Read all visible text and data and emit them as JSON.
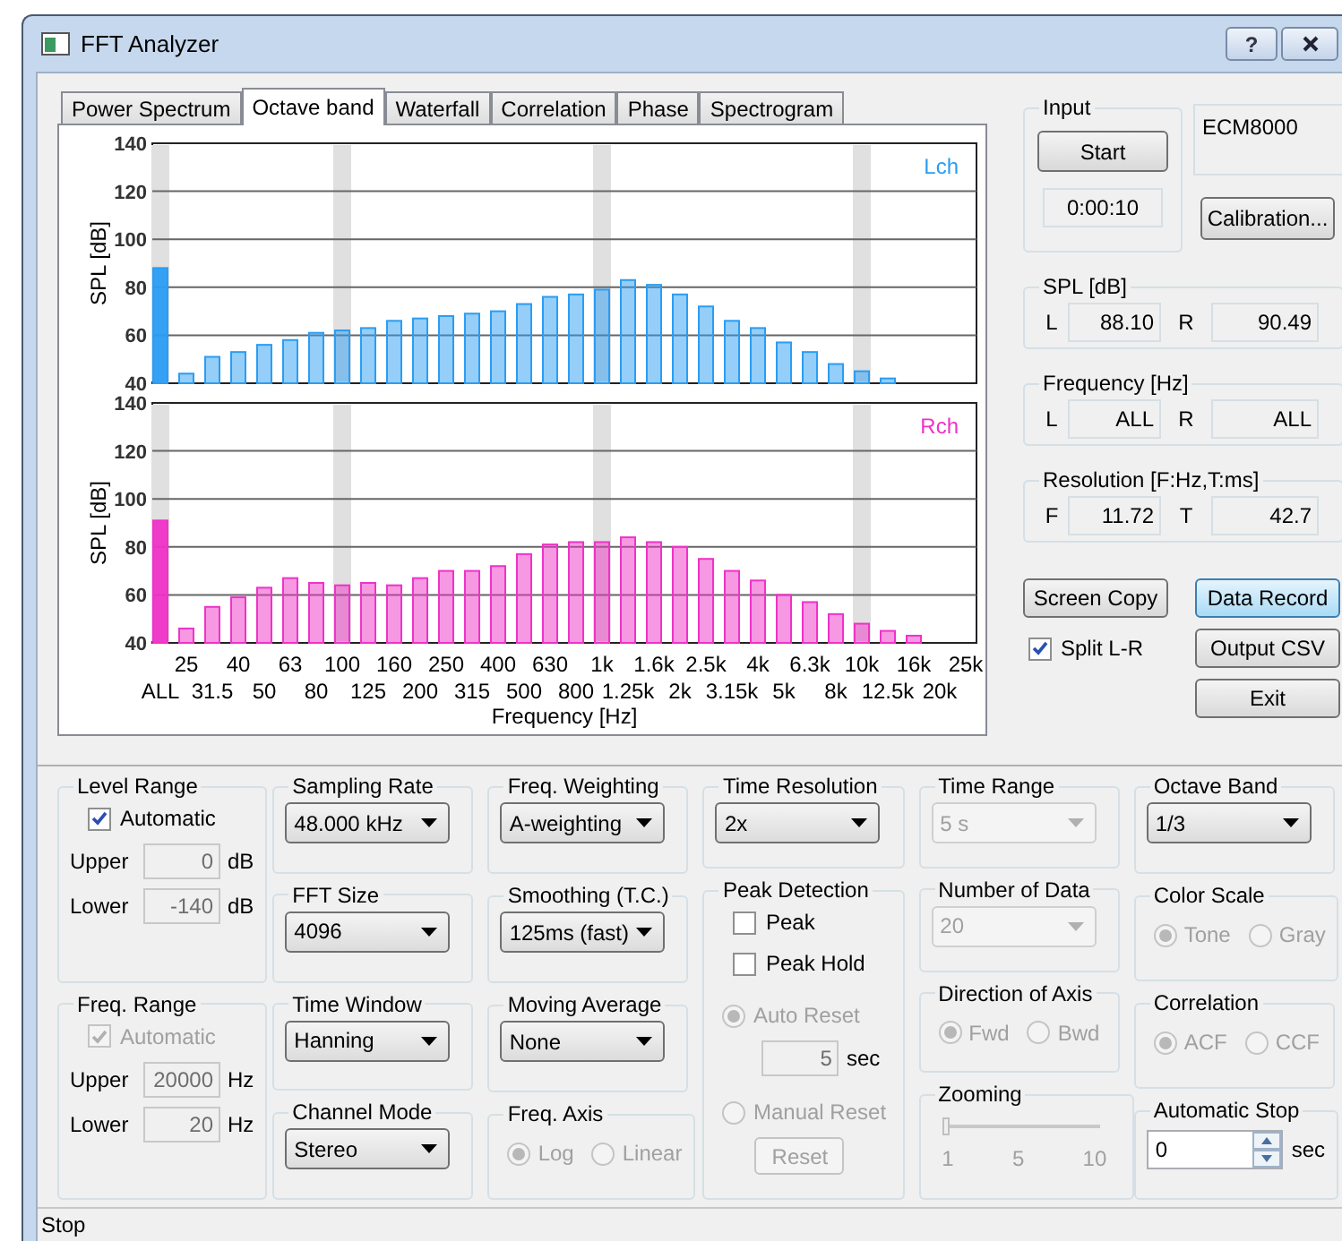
{
  "window": {
    "title": "FFT Analyzer",
    "help_button": "?"
  },
  "tabs": [
    {
      "label": "Power Spectrum",
      "selected": false
    },
    {
      "label": "Octave band",
      "selected": true
    },
    {
      "label": "Waterfall",
      "selected": false
    },
    {
      "label": "Correlation",
      "selected": false
    },
    {
      "label": "Phase",
      "selected": false
    },
    {
      "label": "Spectrogram",
      "selected": false
    }
  ],
  "plots": [
    {
      "chart_data": {
        "type": "bar",
        "grid": true,
        "ylabel": "SPL [dB]",
        "ylim": [
          40,
          140
        ],
        "yticks": [
          40,
          60,
          80,
          100,
          120,
          140
        ],
        "series": [
          {
            "name": "Lch",
            "color": "#2a9df4",
            "values": [
              88,
              44,
              51,
              53,
              56,
              58,
              61,
              62,
              63,
              66,
              67,
              68,
              69,
              70,
              73,
              76,
              77,
              79,
              83,
              81,
              77,
              72,
              66,
              63,
              57,
              53,
              48,
              45,
              42,
              null,
              null,
              null
            ]
          }
        ]
      }
    },
    {
      "chart_data": {
        "type": "bar",
        "grid": true,
        "xlabel": "Frequency [Hz]",
        "ylabel": "SPL [dB]",
        "ylim": [
          40,
          140
        ],
        "yticks": [
          40,
          60,
          80,
          100,
          120,
          140
        ],
        "categories": [
          "ALL",
          "25",
          "31.5",
          "40",
          "50",
          "63",
          "80",
          "100",
          "125",
          "160",
          "200",
          "250",
          "315",
          "400",
          "500",
          "630",
          "800",
          "1k",
          "1.25k",
          "1.6k",
          "2k",
          "2.5k",
          "3.15k",
          "4k",
          "5k",
          "6.3k",
          "8k",
          "10k",
          "12.5k",
          "16k",
          "20k",
          "25k"
        ],
        "series": [
          {
            "name": "Rch",
            "color": "#f032c8",
            "values": [
              91,
              46,
              55,
              59,
              63,
              67,
              65,
              64,
              65,
              64,
              67,
              70,
              70,
              72,
              77,
              81,
              82,
              82,
              84,
              82,
              80,
              75,
              70,
              66,
              60,
              57,
              52,
              48,
              45,
              43,
              null,
              null
            ]
          }
        ]
      }
    }
  ],
  "input": {
    "title": "Input",
    "start_button": "Start",
    "elapsed": "0:00:10"
  },
  "device": {
    "name": "ECM8000",
    "calibration_button": "Calibration..."
  },
  "readouts": [
    {
      "title": "SPL [dB]",
      "fields": [
        {
          "label": "L",
          "value": "88.10"
        },
        {
          "label": "R",
          "value": "90.49"
        }
      ]
    },
    {
      "title": "Frequency [Hz]",
      "fields": [
        {
          "label": "L",
          "value": "ALL"
        },
        {
          "label": "R",
          "value": "ALL"
        }
      ]
    },
    {
      "title": "Resolution [F:Hz,T:ms]",
      "fields": [
        {
          "label": "F",
          "value": "11.72"
        },
        {
          "label": "T",
          "value": "42.7"
        }
      ]
    }
  ],
  "actions": {
    "screen_copy": {
      "label": "Screen Copy",
      "highlighted": false
    },
    "data_record": {
      "label": "Data Record",
      "highlighted": true
    },
    "split": {
      "label": "Split L-R",
      "checked": true
    },
    "output_csv": {
      "label": "Output CSV",
      "highlighted": false
    },
    "exit": {
      "label": "Exit",
      "highlighted": false
    }
  },
  "settings": {
    "columns": [
      [
        {
          "title": "Level Range",
          "controls": [
            {
              "kind": "checkbox",
              "label": "Automatic",
              "checked": true,
              "disabled": false
            },
            {
              "kind": "field",
              "label": "Upper",
              "value": "0",
              "unit": "dB",
              "disabled": true
            },
            {
              "kind": "field",
              "label": "Lower",
              "value": "-140",
              "unit": "dB",
              "disabled": true
            }
          ]
        },
        {
          "title": "Freq. Range",
          "controls": [
            {
              "kind": "checkbox",
              "label": "Automatic",
              "checked": true,
              "disabled": true
            },
            {
              "kind": "field",
              "label": "Upper",
              "value": "20000",
              "unit": "Hz",
              "disabled": true
            },
            {
              "kind": "field",
              "label": "Lower",
              "value": "20",
              "unit": "Hz",
              "disabled": true
            }
          ]
        }
      ],
      [
        {
          "title": "Sampling Rate",
          "controls": [
            {
              "kind": "dropdown",
              "value": "48.000 kHz",
              "disabled": false
            }
          ]
        },
        {
          "title": "FFT Size",
          "controls": [
            {
              "kind": "dropdown",
              "value": "4096",
              "disabled": false
            }
          ]
        },
        {
          "title": "Time Window",
          "controls": [
            {
              "kind": "dropdown",
              "value": "Hanning",
              "disabled": false
            }
          ]
        },
        {
          "title": "Channel Mode",
          "controls": [
            {
              "kind": "dropdown",
              "value": "Stereo",
              "disabled": false
            }
          ]
        }
      ],
      [
        {
          "title": "Freq. Weighting",
          "controls": [
            {
              "kind": "dropdown",
              "value": "A-weighting",
              "disabled": false
            }
          ]
        },
        {
          "title": "Smoothing (T.C.)",
          "controls": [
            {
              "kind": "dropdown",
              "value": "125ms (fast)",
              "disabled": false
            }
          ]
        },
        {
          "title": "Moving Average",
          "controls": [
            {
              "kind": "dropdown",
              "value": "None",
              "disabled": false
            }
          ]
        },
        {
          "title": "Freq. Axis",
          "controls": [
            {
              "kind": "radios",
              "disabled": true,
              "options": [
                {
                  "label": "Log",
                  "selected": true
                },
                {
                  "label": "Linear",
                  "selected": false
                }
              ]
            }
          ]
        }
      ],
      [
        {
          "title": "Time Resolution",
          "controls": [
            {
              "kind": "dropdown",
              "value": "2x",
              "disabled": false
            }
          ]
        },
        {
          "title": "Peak Detection",
          "controls": [
            {
              "kind": "checkbox",
              "label": "Peak",
              "checked": false,
              "disabled": false
            },
            {
              "kind": "checkbox",
              "label": "Peak Hold",
              "checked": false,
              "disabled": false
            },
            {
              "kind": "radio",
              "label": "Auto Reset",
              "selected": true,
              "disabled": true
            },
            {
              "kind": "field",
              "value": "5",
              "unit": "sec",
              "disabled": true
            },
            {
              "kind": "radio",
              "label": "Manual Reset",
              "selected": false,
              "disabled": true
            },
            {
              "kind": "button",
              "label": "Reset",
              "disabled": true
            }
          ]
        }
      ],
      [
        {
          "title": "Time Range",
          "controls": [
            {
              "kind": "dropdown",
              "value": "5 s",
              "disabled": true
            }
          ]
        },
        {
          "title": "Number of Data",
          "controls": [
            {
              "kind": "dropdown",
              "value": "20",
              "disabled": true
            }
          ]
        },
        {
          "title": "Direction of Axis",
          "controls": [
            {
              "kind": "radios",
              "disabled": true,
              "options": [
                {
                  "label": "Fwd",
                  "selected": true
                },
                {
                  "label": "Bwd",
                  "selected": false
                }
              ]
            }
          ]
        },
        {
          "title": "Zooming",
          "controls": [
            {
              "kind": "slider",
              "level": 0,
              "ticks": [
                "1",
                "5",
                "10"
              ],
              "disabled": true
            }
          ]
        }
      ],
      [
        {
          "title": "Octave Band",
          "controls": [
            {
              "kind": "dropdown",
              "value": "1/3",
              "disabled": false
            }
          ]
        },
        {
          "title": "Color Scale",
          "controls": [
            {
              "kind": "radios",
              "disabled": true,
              "options": [
                {
                  "label": "Tone",
                  "selected": true
                },
                {
                  "label": "Gray",
                  "selected": false
                }
              ]
            }
          ]
        },
        {
          "title": "Correlation",
          "controls": [
            {
              "kind": "radios",
              "disabled": true,
              "options": [
                {
                  "label": "ACF",
                  "selected": true
                },
                {
                  "label": "CCF",
                  "selected": false
                }
              ]
            }
          ]
        },
        {
          "title": "Automatic Stop",
          "controls": [
            {
              "kind": "spinner",
              "value": "0",
              "unit": "sec"
            }
          ]
        }
      ]
    ]
  },
  "status_bar": {
    "text": "Stop"
  }
}
